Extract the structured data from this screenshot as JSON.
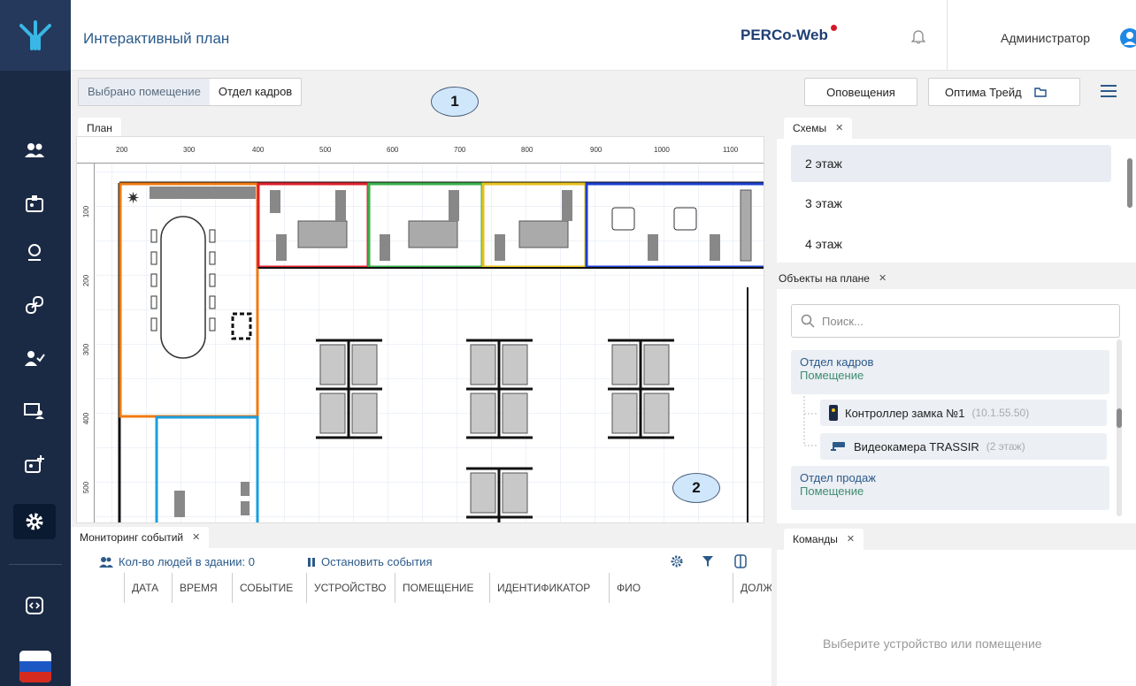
{
  "header": {
    "title": "Интерактивный план",
    "brand": "PERCo-Web",
    "user": "Администратор"
  },
  "selection": {
    "label": "Выбрано помещение",
    "value": "Отдел кадров"
  },
  "callouts": [
    "1",
    "2"
  ],
  "toolbar_right": {
    "notifications": "Оповещения",
    "company": "Оптима Трейд"
  },
  "plan_tab": {
    "label": "План",
    "ruler_h": [
      "200",
      "300",
      "400",
      "500",
      "600",
      "700",
      "800",
      "900",
      "1000",
      "1100"
    ],
    "ruler_v": [
      "100",
      "200",
      "300",
      "400",
      "500"
    ]
  },
  "schemes": {
    "tab": "Схемы",
    "items": [
      "2 этаж",
      "3 этаж",
      "4 этаж"
    ]
  },
  "objects": {
    "tab": "Объекты на плане",
    "search_placeholder": "Поиск...",
    "groups": [
      {
        "name": "Отдел кадров",
        "type": "Помещение"
      },
      {
        "name": "Отдел продаж",
        "type": "Помещение"
      }
    ],
    "devices": [
      {
        "name": "Контроллер замка №1",
        "detail": "(10.1.55.50)"
      },
      {
        "name": "Видеокамера TRASSIR",
        "detail": "(2 этаж)"
      }
    ]
  },
  "monitoring": {
    "tab": "Мониторинг событий",
    "people_count": "Кол-во людей в здании: 0",
    "stop": "Остановить события",
    "columns": [
      "ДАТА",
      "ВРЕМЯ",
      "СОБЫТИЕ",
      "УСТРОЙСТВО",
      "ПОМЕЩЕНИЕ",
      "ИДЕНТИФИКАТОР",
      "ФИО",
      "ДОЛЖ"
    ]
  },
  "commands": {
    "tab": "Команды",
    "empty": "Выберите устройство или помещение"
  },
  "colors": {
    "sidebar": "#1b2a44",
    "accent": "#2b5a8a",
    "brand_dot": "#d3192a"
  }
}
